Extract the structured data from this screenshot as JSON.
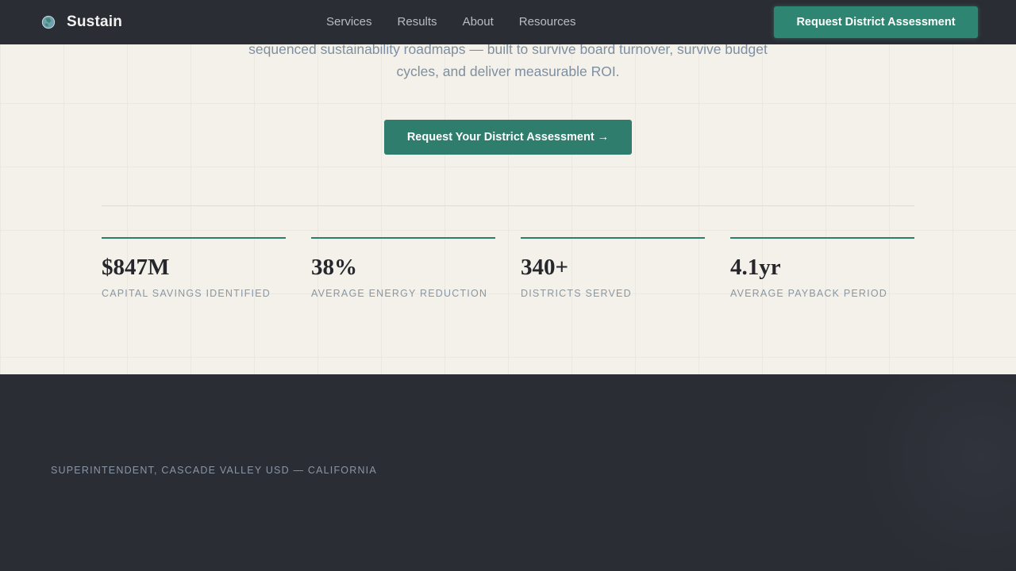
{
  "nav": {
    "brand": "Sustain",
    "brand_icon": "globe-leaf-icon",
    "links": [
      "Services",
      "Results",
      "About",
      "Resources"
    ],
    "cta": "Request District Assessment"
  },
  "hero": {
    "subtitle": "sequenced sustainability roadmaps — built to survive board turnover, survive budget cycles, and deliver measurable ROI.",
    "cta": "Request Your District Assessment →"
  },
  "stats": [
    {
      "value": "$847M",
      "label": "CAPITAL SAVINGS IDENTIFIED"
    },
    {
      "value": "38%",
      "label": "AVERAGE ENERGY REDUCTION"
    },
    {
      "value": "340+",
      "label": "DISTRICTS SERVED"
    },
    {
      "value": "4.1yr",
      "label": "AVERAGE PAYBACK PERIOD"
    }
  ],
  "testimonial": {
    "attribution": "SUPERINTENDENT, CASCADE VALLEY USD — CALIFORNIA"
  },
  "colors": {
    "dark": "#2b2d34",
    "accent": "#2e7d6d",
    "cream": "#f4f1ea"
  }
}
